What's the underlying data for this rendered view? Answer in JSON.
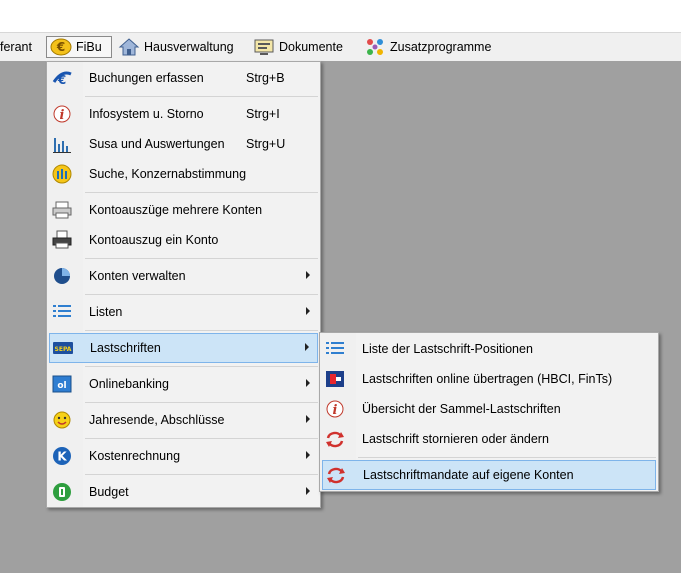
{
  "menubar": {
    "items": [
      {
        "label": "ferant",
        "icon": "none"
      },
      {
        "label": "FiBu",
        "icon": "euro-coin-icon"
      },
      {
        "label": "Hausverwaltung",
        "icon": "house-icon"
      },
      {
        "label": "Dokumente",
        "icon": "document-monitor-icon"
      },
      {
        "label": "Zusatzprogramme",
        "icon": "pinwheel-icon"
      }
    ]
  },
  "fibu_menu": {
    "items": [
      {
        "label": "Buchungen erfassen",
        "shortcut": "Strg+B",
        "icon": "euro-arrow-icon"
      },
      {
        "label": "Infosystem u. Storno",
        "shortcut": "Strg+I",
        "icon": "info-icon"
      },
      {
        "label": "Susa und Auswertungen",
        "shortcut": "Strg+U",
        "icon": "bar-chart-icon"
      },
      {
        "label": "Suche, Konzernabstimmung",
        "shortcut": "",
        "icon": "search-building-icon"
      },
      {
        "label": "Kontoauszüge mehrere Konten",
        "shortcut": "",
        "icon": "printer-icon"
      },
      {
        "label": "Kontoauszug ein Konto",
        "shortcut": "",
        "icon": "printer-page-icon"
      },
      {
        "label": "Konten verwalten",
        "shortcut": "",
        "icon": "pie-icon"
      },
      {
        "label": "Listen",
        "shortcut": "",
        "icon": "list-icon"
      },
      {
        "label": "Lastschriften",
        "shortcut": "",
        "icon": "sepa-card-icon"
      },
      {
        "label": "Onlinebanking",
        "shortcut": "",
        "icon": "bank-icon"
      },
      {
        "label": "Jahresende, Abschlüsse",
        "shortcut": "",
        "icon": "calendar-smiley-icon"
      },
      {
        "label": "Kostenrechnung",
        "shortcut": "",
        "icon": "k-circle-icon"
      },
      {
        "label": "Budget",
        "shortcut": "",
        "icon": "b-circle-icon"
      }
    ]
  },
  "lastschriften_menu": {
    "items": [
      {
        "label": "Liste der Lastschrift-Positionen",
        "icon": "list-icon"
      },
      {
        "label": "Lastschriften online übertragen (HBCI, FinTs)",
        "icon": "hbci-icon"
      },
      {
        "label": "Übersicht der Sammel-Lastschriften",
        "icon": "info-icon"
      },
      {
        "label": "Lastschrift stornieren oder ändern",
        "icon": "refresh-icon"
      },
      {
        "label": "Lastschriftmandate auf eigene Konten",
        "icon": "refresh-icon"
      }
    ]
  },
  "colors": {
    "highlight_bg": "#cce4f7",
    "highlight_border": "#7eb4ea",
    "workspace": "#a0a0a0"
  }
}
